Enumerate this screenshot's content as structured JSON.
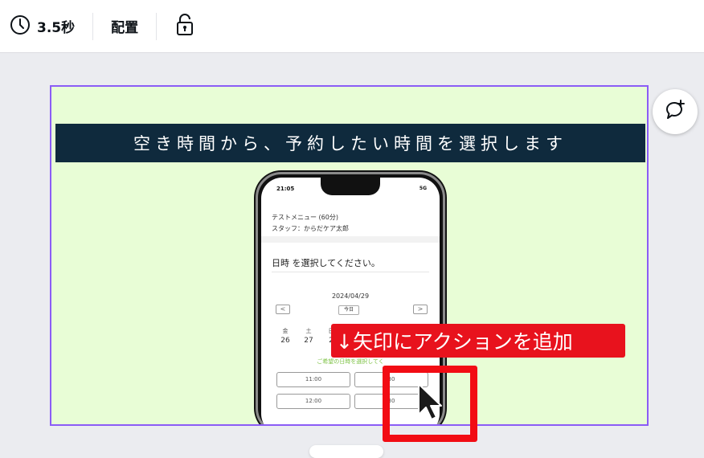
{
  "toolbar": {
    "duration": "3.5秒",
    "arrange_label": "配置"
  },
  "slide": {
    "banner_text": "空き時間から、予約したい時間を選択します"
  },
  "phone": {
    "status_time": "21:05",
    "status_right": "5G",
    "menu_name": "テストメニュー (60分)",
    "staff": "スタッフ：からだケア太郎",
    "select_title": "日時 を選択してください。",
    "date": "2024/04/29",
    "prev": "<",
    "next": ">",
    "today": "今日",
    "weekdays": [
      "金",
      "土",
      "日"
    ],
    "days": [
      "26",
      "27",
      "2"
    ],
    "hint": "ご希望の日時を選択してく",
    "slots": [
      "11:00",
      "30",
      "12:00",
      "30"
    ]
  },
  "annotation": {
    "callout_text": "↓矢印にアクションを追加"
  },
  "colors": {
    "canvas_bg": "#e8fdd6",
    "banner_bg": "#0f2a3d",
    "selection_border": "#8b5cf6",
    "callout_red": "#e8121d"
  }
}
